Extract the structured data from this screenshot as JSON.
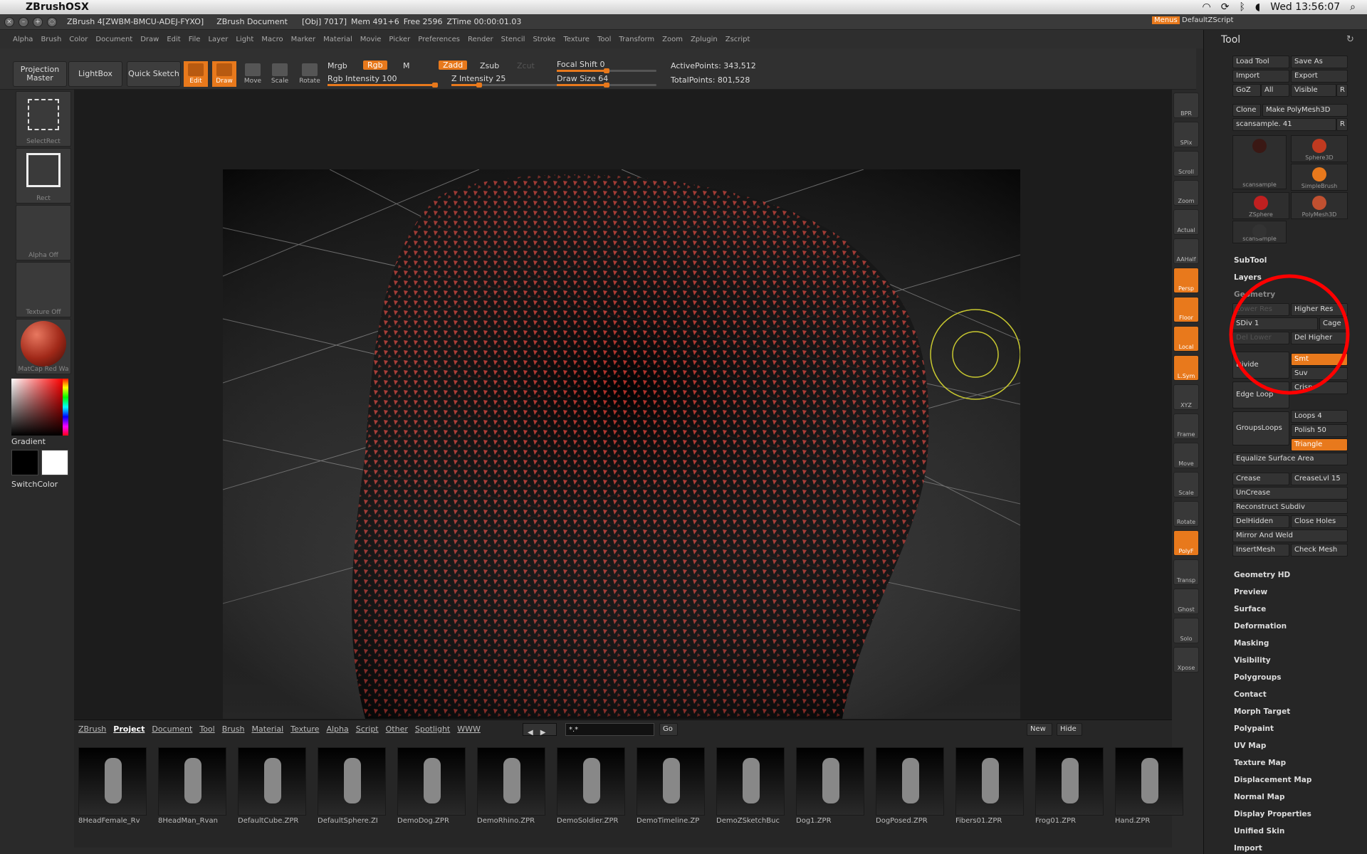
{
  "mac": {
    "app": "ZBrushOSX",
    "clock": "Wed 13:56:07"
  },
  "title": {
    "doc": "ZBrush 4[ZWBM-BMCU-ADEJ-FYXO]",
    "name": "ZBrush Document",
    "obj": "[Obj] 7017]",
    "mem": "Mem 491+6",
    "free": "Free 2596",
    "ztime": "ZTime 00:00:01.03",
    "menus": "Menus",
    "script": "DefaultZScript"
  },
  "menus": [
    "Alpha",
    "Brush",
    "Color",
    "Document",
    "Draw",
    "Edit",
    "File",
    "Layer",
    "Light",
    "Macro",
    "Marker",
    "Material",
    "Movie",
    "Picker",
    "Preferences",
    "Render",
    "Stencil",
    "Stroke",
    "Texture",
    "Tool",
    "Transform",
    "Zoom",
    "Zplugin",
    "Zscript"
  ],
  "toolbar": {
    "projection": "Projection Master",
    "lightbox": "LightBox",
    "quick": "Quick Sketch",
    "edit": "Edit",
    "draw": "Draw",
    "move": "Move",
    "scale": "Scale",
    "rotate": "Rotate",
    "mrgb": "Mrgb",
    "rgb": "Rgb",
    "m": "M",
    "zadd": "Zadd",
    "zsub": "Zsub",
    "zcut": "Zcut",
    "rgb_int": "Rgb Intensity 100",
    "z_int": "Z Intensity 25",
    "focal": "Focal Shift 0",
    "drawsize": "Draw Size 64",
    "active": "ActivePoints: 343,512",
    "total": "TotalPoints: 801,528"
  },
  "left": {
    "select": "SelectRect",
    "rect": "Rect",
    "alpha": "Alpha Off",
    "texture": "Texture Off",
    "matcap": "MatCap Red Wa",
    "gradient": "Gradient",
    "switch": "SwitchColor"
  },
  "right_shelf": [
    "BPR",
    "SPix",
    "Scroll",
    "Zoom",
    "Actual",
    "AAHalf",
    "Persp",
    "Floor",
    "Local",
    "L.Sym",
    "XYZ",
    "Frame",
    "Move",
    "Scale",
    "Rotate",
    "PolyF",
    "Transp",
    "Ghost",
    "Solo",
    "Xpose"
  ],
  "tool": {
    "title": "Tool",
    "load": "Load Tool",
    "saveas": "Save As",
    "import": "Import",
    "export": "Export",
    "goz": "GoZ",
    "all": "All",
    "visible": "Visible",
    "r": "R",
    "clone": "Clone",
    "makepm": "Make PolyMesh3D",
    "scan": "scansample. 41",
    "thumbs": [
      "scansample",
      "Sphere3D",
      "SimpleBrush",
      "ZSphere",
      "PolyMesh3D",
      "scansample"
    ],
    "subtool": "SubTool",
    "layers": "Layers",
    "geometry": "Geometry",
    "lower": "Lower Res",
    "higher": "Higher Res",
    "sdiv": "SDiv 1",
    "cage": "Cage",
    "dellower": "Del Lower",
    "delhigher": "Del Higher",
    "divide": "Divide",
    "smt": "Smt",
    "suv": "Suv",
    "crisp": "Crisp",
    "edgeloop": "Edge Loop",
    "groupsloops": "GroupsLoops",
    "loops": "Loops 4",
    "polish": "Polish 50",
    "triangle": "Triangle",
    "equalize": "Equalize Surface Area",
    "crease": "Crease",
    "creaselvl": "CreaseLvl 15",
    "uncrease": "UnCrease",
    "reconstruct": "Reconstruct Subdiv",
    "delhidden": "DelHidden",
    "closeholes": "Close Holes",
    "mirror": "Mirror And Weld",
    "insert": "InsertMesh",
    "check": "Check Mesh",
    "sections": [
      "Geometry HD",
      "Preview",
      "Surface",
      "Deformation",
      "Masking",
      "Visibility",
      "Polygroups",
      "Contact",
      "Morph Target",
      "Polypaint",
      "UV Map",
      "Texture Map",
      "Displacement Map",
      "Normal Map",
      "Display Properties",
      "Unified Skin",
      "Import"
    ]
  },
  "lightbox": {
    "tabs": [
      "ZBrush",
      "Project",
      "Document",
      "Tool",
      "Brush",
      "Material",
      "Texture",
      "Alpha",
      "Script",
      "Other",
      "Spotlight",
      "WWW"
    ],
    "search": "*.*",
    "go": "Go",
    "new": "New",
    "hide": "Hide",
    "items": [
      "8HeadFemale_Rv",
      "8HeadMan_Rvan",
      "DefaultCube.ZPR",
      "DefaultSphere.ZI",
      "DemoDog.ZPR",
      "DemoRhino.ZPR",
      "DemoSoldier.ZPR",
      "DemoTimeline.ZP",
      "DemoZSketchBuc",
      "Dog1.ZPR",
      "DogPosed.ZPR",
      "Fibers01.ZPR",
      "Frog01.ZPR",
      "Hand.ZPR"
    ]
  },
  "colors": {
    "accent": "#e8791c",
    "highlight_circle": "#ff0000"
  }
}
